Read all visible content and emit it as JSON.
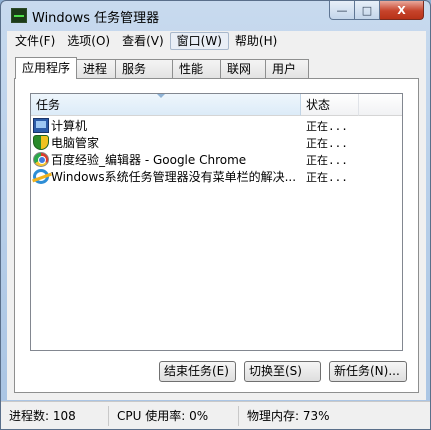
{
  "window": {
    "title": "Windows 任务管理器"
  },
  "caption": {
    "minimize": "—",
    "maximize": "□",
    "close": "X"
  },
  "menu": [
    "文件(F)",
    "选项(O)",
    "查看(V)",
    "窗口(W)",
    "帮助(H)"
  ],
  "tabs": [
    "应用程序",
    "进程",
    "服务",
    "性能",
    "联网",
    "用户"
  ],
  "columns": {
    "task": "任务",
    "status": "状态"
  },
  "rows": [
    {
      "icon": "computer-icon",
      "name": "计算机",
      "status": "正在..."
    },
    {
      "icon": "shield-icon",
      "name": "电脑管家",
      "status": "正在..."
    },
    {
      "icon": "chrome-icon",
      "name": "百度经验_编辑器 - Google Chrome",
      "status": "正在..."
    },
    {
      "icon": "ie-icon",
      "name": "Windows系统任务管理器没有菜单栏的解决...",
      "status": "正在..."
    }
  ],
  "buttons": {
    "end_task": "结束任务(E)",
    "switch_to": "切换至(S)",
    "new_task": "新任务(N)..."
  },
  "status_bar": {
    "processes": "进程数: 108",
    "cpu": "CPU 使用率: 0%",
    "memory": "物理内存: 73%"
  }
}
